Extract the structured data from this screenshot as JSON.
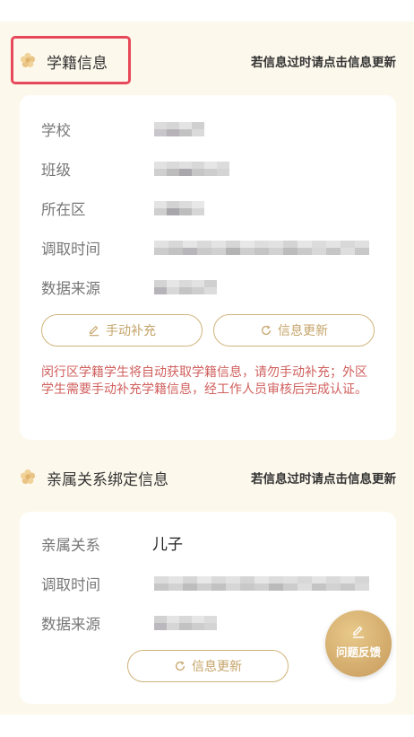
{
  "section_student": {
    "title": "学籍信息",
    "hint": "若信息过时请点击信息更新",
    "rows": [
      {
        "label": "学校"
      },
      {
        "label": "班级"
      },
      {
        "label": "所在区"
      },
      {
        "label": "调取时间"
      },
      {
        "label": "数据来源"
      }
    ],
    "manual_button": "手动补充",
    "update_button": "信息更新",
    "notice": "闵行区学籍学生将自动获取学籍信息，请勿手动补充；外区学生需要手动补充学籍信息，经工作人员审核后完成认证。"
  },
  "section_relation": {
    "title": "亲属关系绑定信息",
    "hint": "若信息过时请点击信息更新",
    "rows": [
      {
        "label": "亲属关系",
        "value": "儿子"
      },
      {
        "label": "调取时间"
      },
      {
        "label": "数据来源"
      }
    ],
    "update_button": "信息更新"
  },
  "feedback": {
    "label": "问题反馈"
  },
  "colors": {
    "accent": "#c5a469",
    "panel_bg": "#fdf8ec",
    "notice": "#d0605e",
    "highlight": "#e8495a"
  },
  "icons": {
    "section": "flower-icon",
    "manual": "pencil-icon",
    "update": "refresh-icon",
    "feedback": "pencil-icon"
  }
}
